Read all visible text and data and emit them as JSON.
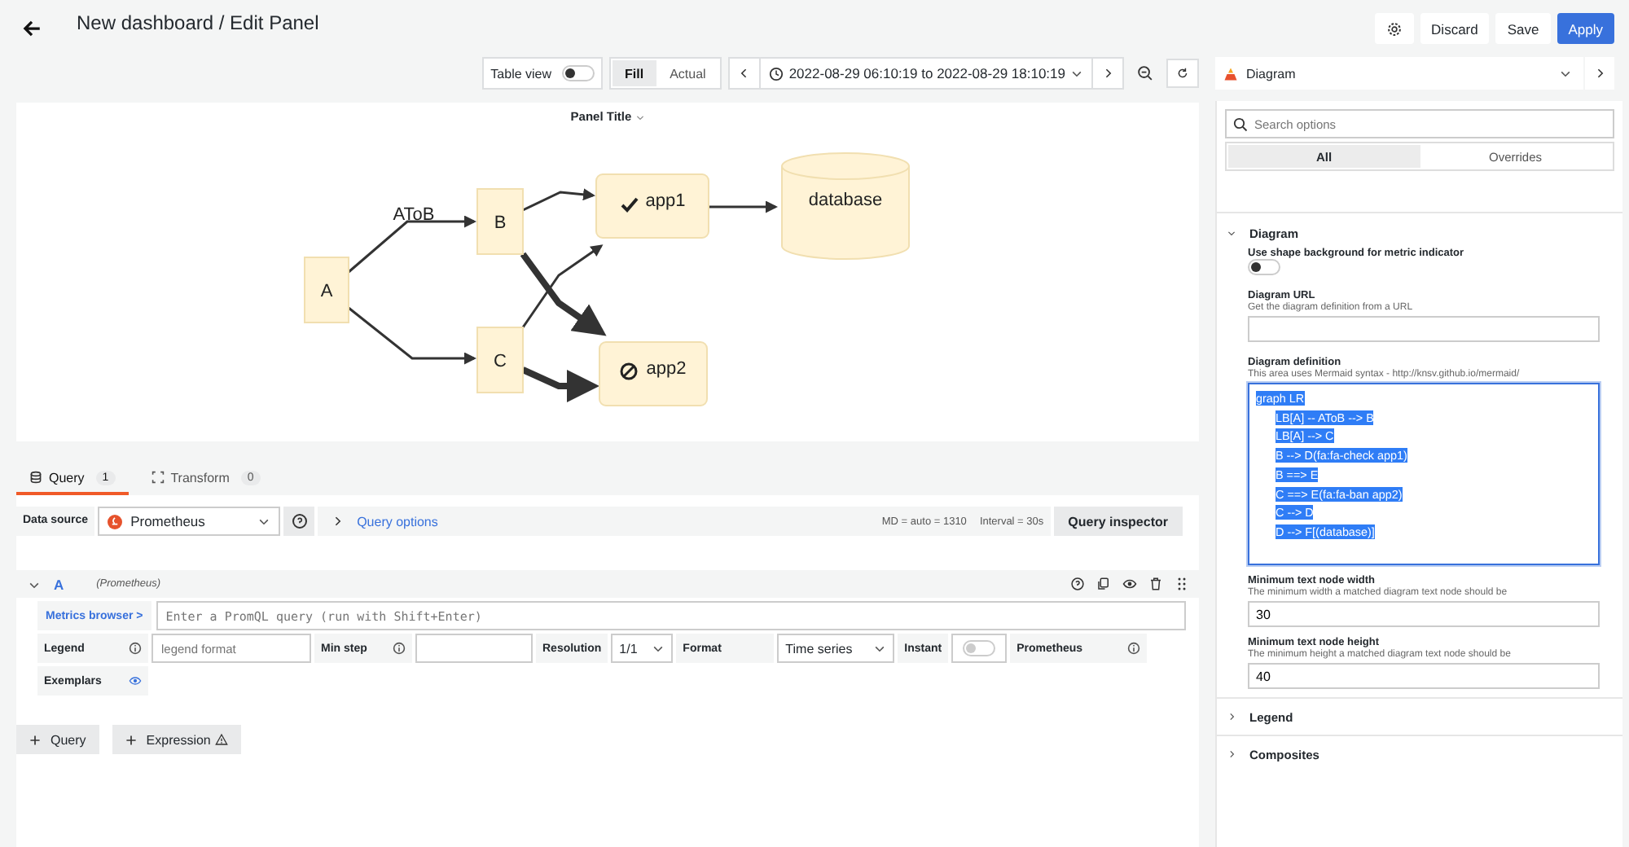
{
  "header": {
    "title": "New dashboard / Edit Panel",
    "buttons": [
      {
        "label": "Discard",
        "kind": "secondary"
      },
      {
        "label": "Save",
        "kind": "secondary"
      },
      {
        "label": "Apply",
        "kind": "primary"
      }
    ]
  },
  "toolbar": {
    "table_view": {
      "label": "Table view",
      "on": false
    },
    "fit": [
      {
        "label": "Fill",
        "selected": true
      },
      {
        "label": "Actual",
        "selected": false
      }
    ],
    "time_range": "2022-08-29 06:10:19 to 2022-08-29 18:10:19"
  },
  "panel": {
    "title": "Panel Title",
    "diagram": {
      "nodes": [
        {
          "label": "A",
          "kind": "box"
        },
        {
          "label": "B",
          "kind": "box"
        },
        {
          "label": "C",
          "kind": "box"
        },
        {
          "label": "app1",
          "kind": "rounded"
        },
        {
          "label": "app2",
          "kind": "rounded"
        },
        {
          "label": "database",
          "kind": "cylinder"
        }
      ],
      "edges": [
        {
          "kind": "thin",
          "label": "AToB"
        },
        {
          "kind": "thin"
        },
        {
          "kind": "thin"
        },
        {
          "kind": "thick"
        },
        {
          "kind": "thick"
        },
        {
          "kind": "thin"
        },
        {
          "kind": "thin"
        }
      ]
    }
  },
  "query_tabs": [
    {
      "label": "Query",
      "count": "1",
      "selected": true
    },
    {
      "label": "Transform",
      "count": "0",
      "selected": false
    }
  ],
  "data_source": {
    "label": "Data source",
    "value": "Prometheus",
    "query_options": "Query options",
    "md": "MD = auto = 1310",
    "interval": "Interval = 30s",
    "inspector": "Query inspector"
  },
  "query": {
    "ref": "A",
    "source": "(Prometheus)",
    "expanded": true,
    "metrics_browser": "Metrics browser >",
    "placeholder": "Enter a PromQL query (run with Shift+Enter)",
    "legend": {
      "label": "Legend",
      "placeholder": "legend format"
    },
    "min_step": {
      "label": "Min step"
    },
    "resolution": {
      "label": "Resolution",
      "value": "1/1"
    },
    "format": {
      "label": "Format",
      "value": "Time series"
    },
    "instant": {
      "label": "Instant",
      "on": false
    },
    "type_label": "Prometheus",
    "exemplars": "Exemplars"
  },
  "add_buttons": [
    "Query",
    "Expression"
  ],
  "options": {
    "visualization": "Diagram",
    "search_placeholder": "Search options",
    "tabs": [
      {
        "label": "All",
        "selected": true
      },
      {
        "label": "Overrides",
        "selected": false
      }
    ],
    "section": {
      "title": "Diagram",
      "expanded": true
    },
    "shape_background": {
      "label": "Use shape background for metric indicator",
      "on": false
    },
    "diagram_url": {
      "label": "Diagram URL",
      "description": "Get the diagram definition from a URL"
    },
    "definition": {
      "label": "Diagram definition",
      "description": "This area uses Mermaid syntax - http://knsv.github.io/mermaid/",
      "selected": true,
      "lines": [
        {
          "text": "graph LR",
          "children": [
            {
              "text": "LB[A] -- AToB --> B"
            },
            {
              "text": "LB[A] --> C"
            },
            {
              "text": "B --> D(fa:fa-check app1)"
            },
            {
              "text": "B ==> E"
            },
            {
              "text": "C ==> E(fa:fa-ban app2)"
            },
            {
              "text": "C --> D"
            },
            {
              "text": "D --> F[(database)]"
            }
          ]
        }
      ]
    },
    "min_width": {
      "label": "Minimum text node width",
      "description": "The minimum width a matched diagram text node should be",
      "value": "30"
    },
    "min_height": {
      "label": "Minimum text node height",
      "description": "The minimum height a matched diagram text node should be",
      "value": "40"
    },
    "collapsed_sections": [
      {
        "title": "Legend",
        "expanded": false
      },
      {
        "title": "Composites",
        "expanded": false
      }
    ]
  }
}
